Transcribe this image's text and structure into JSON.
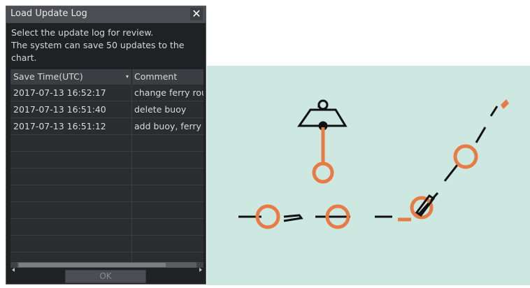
{
  "dialog": {
    "title": "Load Update Log",
    "message_line1": "Select the update log for review.",
    "message_line2": "The system can save 50 updates to the",
    "message_line3": "chart.",
    "columns": [
      "Save Time(UTC)",
      "Comment"
    ],
    "sort_icon": "sort-descending-icon",
    "rows": [
      {
        "time": "2017-07-13 16:52:17",
        "comment": "change ferry route"
      },
      {
        "time": "2017-07-13 16:51:40",
        "comment": "delete buoy"
      },
      {
        "time": "2017-07-13 16:51:12",
        "comment": "add buoy, ferry"
      }
    ],
    "ok_label": "OK",
    "close_icon": "close-icon"
  },
  "colors": {
    "dialog_bg": "#1f2124",
    "accent": "#e87a45",
    "chart_bg": "#cde8e0"
  }
}
